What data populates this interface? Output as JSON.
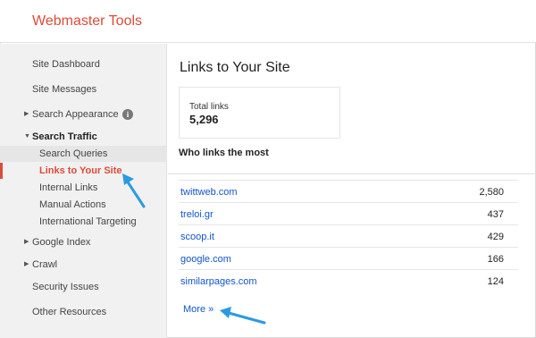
{
  "app": {
    "title": "Webmaster Tools"
  },
  "sidebar": {
    "items": [
      {
        "label": "Site Dashboard"
      },
      {
        "label": "Site Messages"
      },
      {
        "label": "Search Appearance"
      },
      {
        "label": "Search Traffic"
      },
      {
        "label": "Search Queries"
      },
      {
        "label": "Links to Your Site"
      },
      {
        "label": "Internal Links"
      },
      {
        "label": "Manual Actions"
      },
      {
        "label": "International Targeting"
      },
      {
        "label": "Google Index"
      },
      {
        "label": "Crawl"
      },
      {
        "label": "Security Issues"
      },
      {
        "label": "Other Resources"
      }
    ],
    "info_icon": "i"
  },
  "main": {
    "title": "Links to Your Site",
    "total_links_label": "Total links",
    "total_links_value": "5,296",
    "section_heading": "Who links the most",
    "rows": [
      {
        "domain": "twittweb.com",
        "count": "2,580"
      },
      {
        "domain": "treloi.gr",
        "count": "437"
      },
      {
        "domain": "scoop.it",
        "count": "429"
      },
      {
        "domain": "google.com",
        "count": "166"
      },
      {
        "domain": "similarpages.com",
        "count": "124"
      }
    ],
    "more_link": "More »"
  },
  "colors": {
    "brand": "#dd4b39",
    "link": "#1155cc",
    "annotation_arrow": "#2b9be0"
  }
}
